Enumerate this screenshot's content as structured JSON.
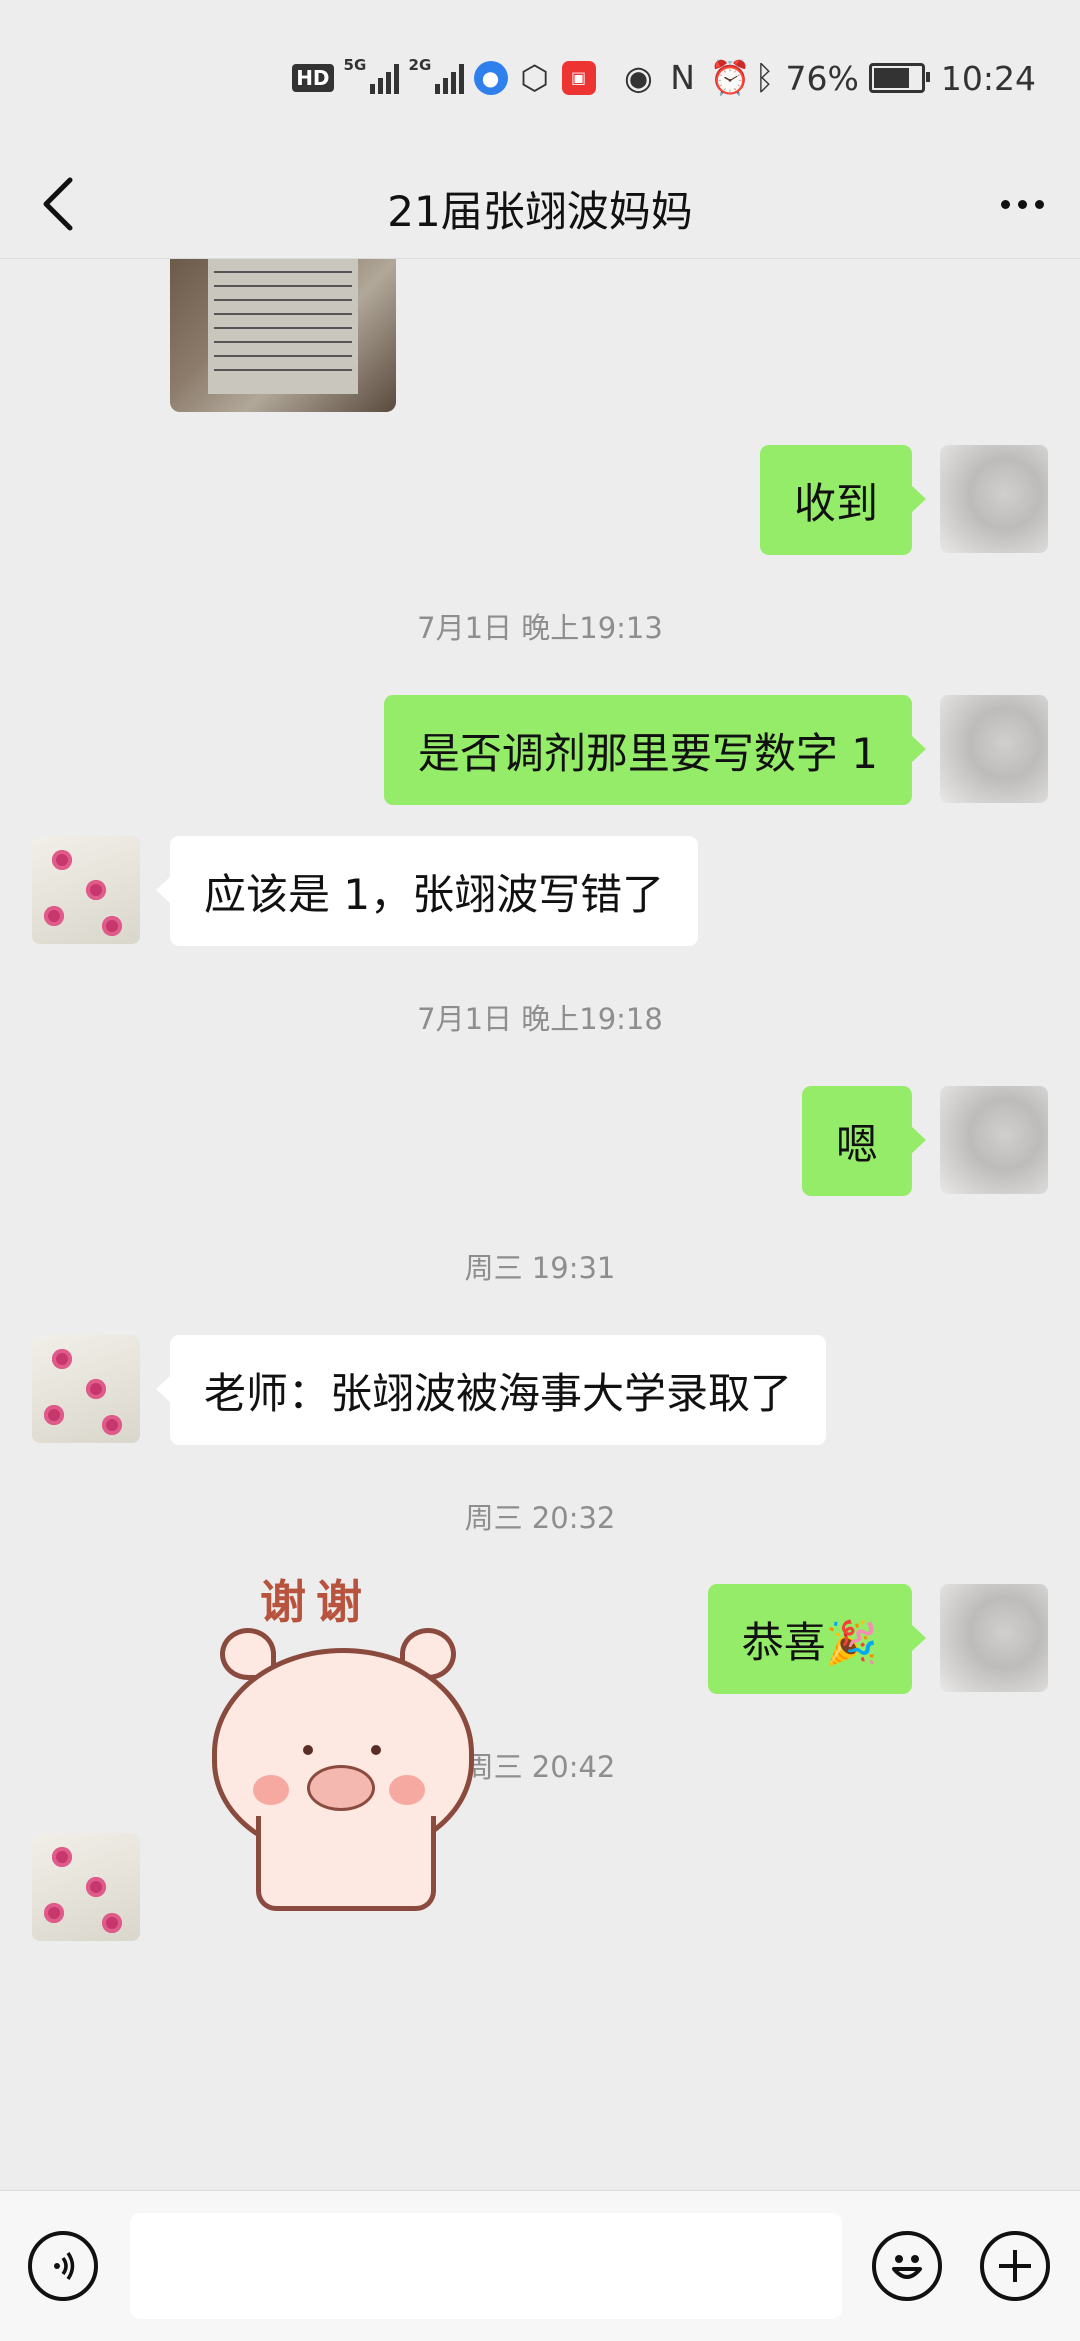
{
  "status_bar": {
    "hd": "HD",
    "net1": "5G",
    "net2": "2G",
    "battery_percent": "76%",
    "battery_level": 0.76,
    "time": "10:24",
    "icons": [
      "hd-icon",
      "signal-5g-icon",
      "signal-2g-icon",
      "app-icon",
      "hexagon-icon",
      "app-icon",
      "eye-icon",
      "nfc-icon",
      "alarm-icon",
      "bluetooth-icon",
      "battery-icon"
    ]
  },
  "header": {
    "title": "21届张翊波妈妈",
    "back_icon": "chevron-left-icon",
    "more_icon": "more-icon"
  },
  "messages": [
    {
      "type": "image",
      "side": "left"
    },
    {
      "type": "text",
      "side": "right",
      "text": "收到"
    },
    {
      "type": "time",
      "text": "7月1日 晚上19:13"
    },
    {
      "type": "text",
      "side": "right",
      "text": "是否调剂那里要写数字 1"
    },
    {
      "type": "text",
      "side": "left",
      "text": "应该是 1，张翊波写错了"
    },
    {
      "type": "time",
      "text": "7月1日 晚上19:18"
    },
    {
      "type": "text",
      "side": "right",
      "text": "嗯"
    },
    {
      "type": "time",
      "text": "周三 19:31"
    },
    {
      "type": "text",
      "side": "left",
      "text": "老师：张翊波被海事大学录取了"
    },
    {
      "type": "time",
      "text": "周三 20:32"
    },
    {
      "type": "text",
      "side": "right",
      "text": "恭喜🎉"
    },
    {
      "type": "time",
      "text": "周三 20:42"
    },
    {
      "type": "sticker",
      "side": "left",
      "text": "谢谢"
    }
  ],
  "input_bar": {
    "voice_icon": "voice-icon",
    "emoji_icon": "emoji-icon",
    "plus_icon": "plus-icon",
    "message_value": ""
  },
  "colors": {
    "background": "#ededed",
    "outgoing_bubble": "#95ec69",
    "incoming_bubble": "#ffffff",
    "timestamp": "#8e8e8e"
  }
}
